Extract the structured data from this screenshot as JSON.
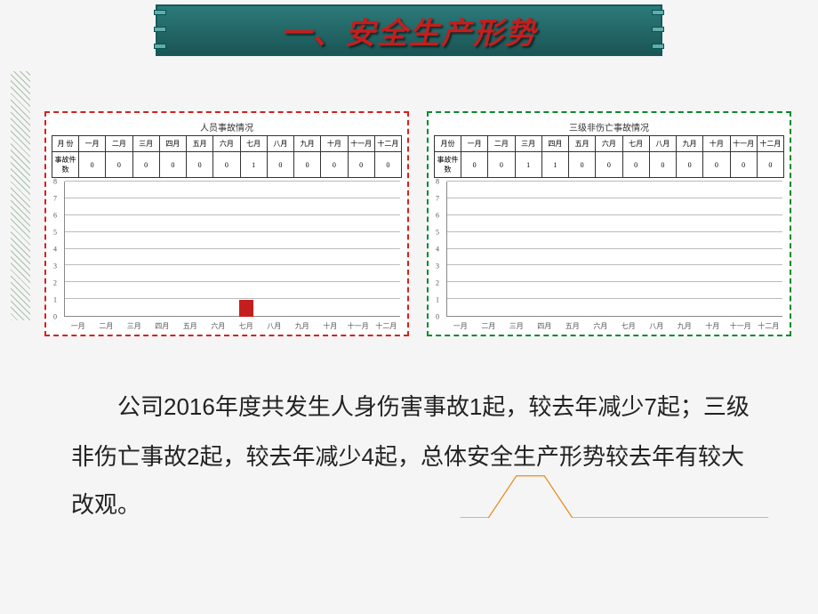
{
  "header": {
    "title": "一、安全生产形势"
  },
  "chart_data": [
    {
      "type": "bar",
      "title": "人员事故情况",
      "row_label_header": "月 份",
      "row_value_header": "事故件数",
      "categories": [
        "一月",
        "二月",
        "三月",
        "四月",
        "五月",
        "六月",
        "七月",
        "八月",
        "九月",
        "十月",
        "十一月",
        "十二月"
      ],
      "values": [
        0,
        0,
        0,
        0,
        0,
        0,
        1,
        0,
        0,
        0,
        0,
        0
      ],
      "ylim": [
        0,
        8
      ],
      "color": "#c41e1e",
      "xlabel": "",
      "ylabel": ""
    },
    {
      "type": "line",
      "title": "三级非伤亡事故情况",
      "row_label_header": "月份",
      "row_value_header": "事故件数",
      "categories": [
        "一月",
        "二月",
        "三月",
        "四月",
        "五月",
        "六月",
        "七月",
        "八月",
        "九月",
        "十月",
        "十一月",
        "十二月"
      ],
      "values": [
        0,
        0,
        1,
        1,
        0,
        0,
        0,
        0,
        0,
        0,
        0,
        0
      ],
      "ylim": [
        0,
        8
      ],
      "color": "#e88a1a",
      "xlabel": "",
      "ylabel": ""
    }
  ],
  "paragraph": {
    "p1a": "公司",
    "p1_year": "2016",
    "p1b": "年度共发生人身伤害事故",
    "p1_n1": "1",
    "p1c": "起，较去年减少",
    "p1_n2": "7",
    "p1d": "起；三级非伤亡事故",
    "p1_n3": "2",
    "p1e": "起，较去年减少",
    "p1_n4": "4",
    "p1f": "起，总体安全生产形势较去年有较大改观。"
  }
}
